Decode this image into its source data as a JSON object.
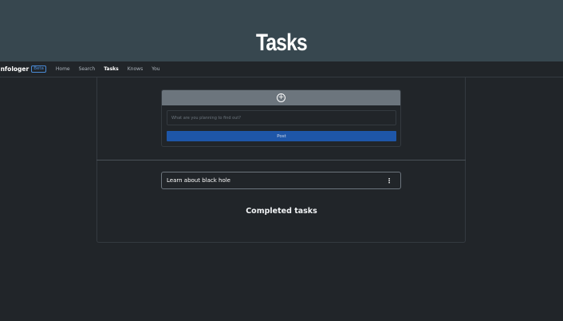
{
  "page": {
    "title": "Tasks"
  },
  "navbar": {
    "brand": "infologer",
    "badge": "Beta",
    "links": [
      {
        "label": "Home",
        "active": false
      },
      {
        "label": "Search",
        "active": false
      },
      {
        "label": "Tasks",
        "active": true
      },
      {
        "label": "Knows",
        "active": false
      },
      {
        "label": "You",
        "active": false
      }
    ]
  },
  "new_task": {
    "icon": "plus-circle-icon",
    "placeholder": "What are you planning to find out?",
    "post_label": "Post"
  },
  "tasks": [
    {
      "text": "Learn about black hole",
      "menu_icon": "kebab-menu-icon"
    }
  ],
  "completed": {
    "heading": "Completed tasks"
  },
  "colors": {
    "hero_bg": "#37474f",
    "body_bg": "#212529",
    "accent": "#1e56a8",
    "form_header": "#6c757d"
  }
}
